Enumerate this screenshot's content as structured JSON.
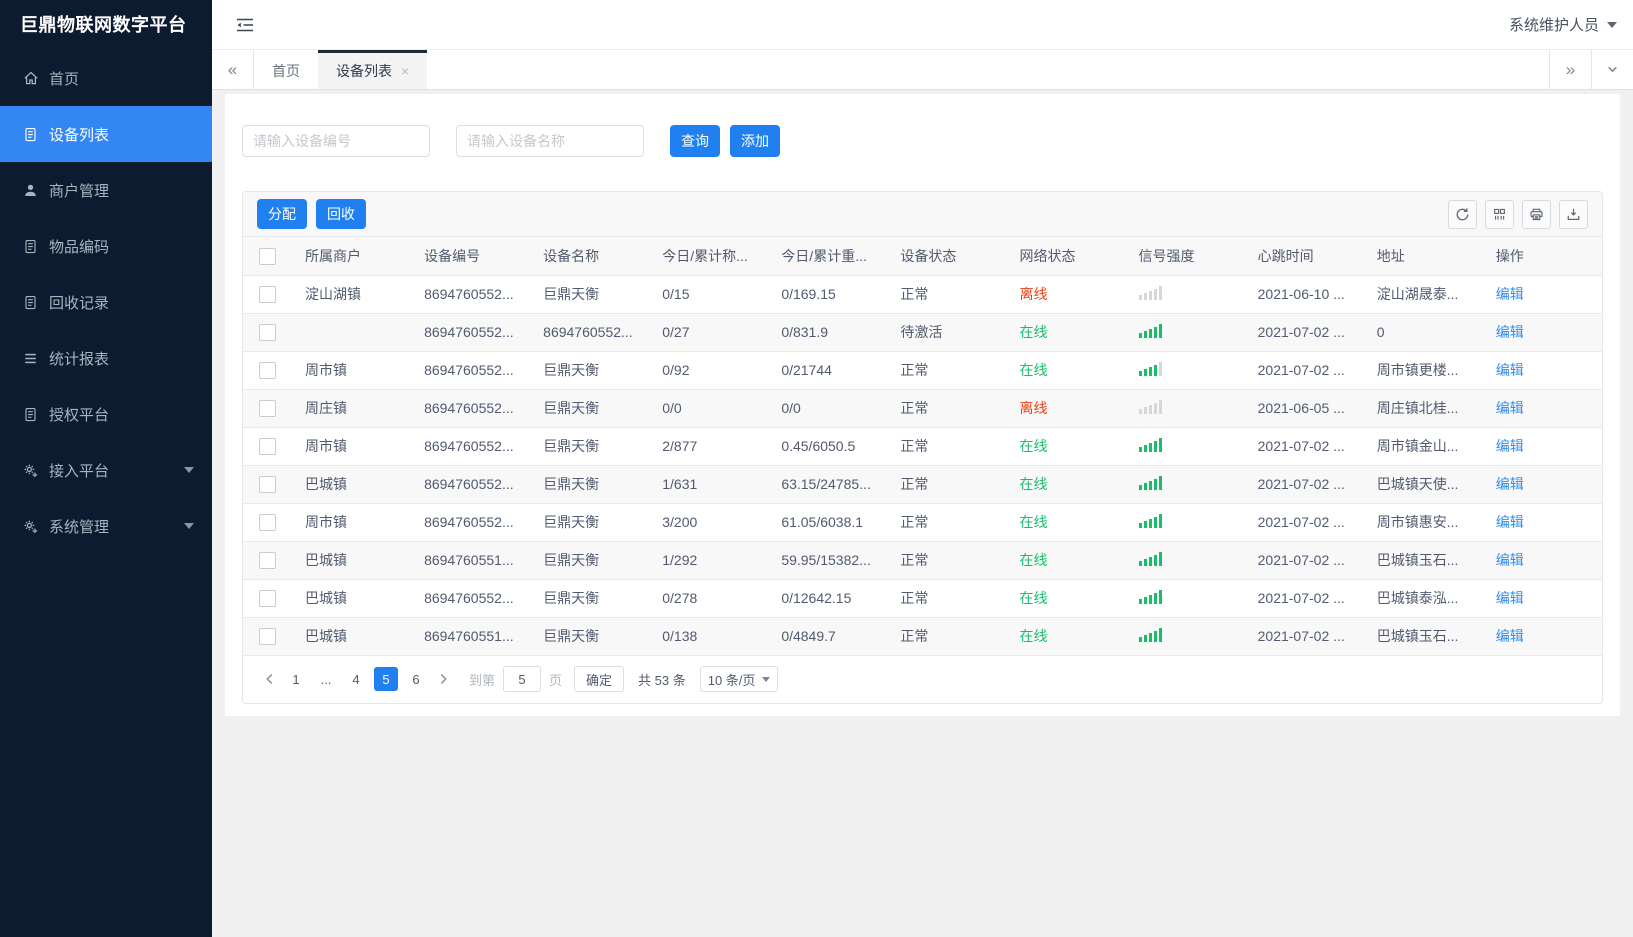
{
  "app": {
    "title": "巨鼎物联网数字平台",
    "user": "系统维护人员"
  },
  "colors": {
    "primary": "#2080f0",
    "green": "#19be6b",
    "red": "#ed4014",
    "link": "#2d8cf0",
    "sidebar": "#0d1b30",
    "active_menu": "#3486f5"
  },
  "sidebar": {
    "items": [
      {
        "id": "home",
        "label": "首页",
        "icon": "home-icon",
        "type": "home",
        "active": false,
        "arrow": false
      },
      {
        "id": "device-list",
        "label": "设备列表",
        "icon": "device-list-icon",
        "type": "doc",
        "active": true,
        "arrow": false
      },
      {
        "id": "merchant-manage",
        "label": "商户管理",
        "icon": "merchant-icon",
        "type": "person",
        "active": false,
        "arrow": false
      },
      {
        "id": "item-code",
        "label": "物品编码",
        "icon": "item-code-icon",
        "type": "doc",
        "active": false,
        "arrow": false
      },
      {
        "id": "recycle-record",
        "label": "回收记录",
        "icon": "recycle-record-icon",
        "type": "doc",
        "active": false,
        "arrow": false
      },
      {
        "id": "report",
        "label": "统计报表",
        "icon": "report-icon",
        "type": "bars",
        "active": false,
        "arrow": false
      },
      {
        "id": "auth-platform",
        "label": "授权平台",
        "icon": "auth-platform-icon",
        "type": "doc",
        "active": false,
        "arrow": false
      },
      {
        "id": "access-platform",
        "label": "接入平台",
        "icon": "access-platform-icon",
        "type": "gear",
        "active": false,
        "arrow": true
      },
      {
        "id": "system-manage",
        "label": "系统管理",
        "icon": "system-manage-icon",
        "type": "gear",
        "active": false,
        "arrow": true
      }
    ]
  },
  "tabs": {
    "items": [
      {
        "label": "首页",
        "active": false,
        "closable": false
      },
      {
        "label": "设备列表",
        "active": true,
        "closable": true
      }
    ]
  },
  "search": {
    "device_no_placeholder": "请输入设备编号",
    "device_name_placeholder": "请输入设备名称",
    "query_label": "查询",
    "add_label": "添加"
  },
  "toolbar": {
    "assign_label": "分配",
    "recycle_label": "回收"
  },
  "table": {
    "headers": [
      "所属商户",
      "设备编号",
      "设备名称",
      "今日/累计称...",
      "今日/累计重...",
      "设备状态",
      "网络状态",
      "信号强度",
      "心跳时间",
      "地址",
      "操作"
    ],
    "edit_label": "编辑",
    "rows": [
      {
        "merchant": "淀山湖镇",
        "device_no": "8694760552...",
        "device_name": "巨鼎天衡",
        "today_count": "0/15",
        "today_weight": "0/169.15",
        "device_status": "正常",
        "network": "离线",
        "network_state": "red",
        "signal": 0,
        "heartbeat": "2021-06-10 ...",
        "address": "淀山湖晟泰..."
      },
      {
        "merchant": "",
        "device_no": "8694760552...",
        "device_name": "8694760552...",
        "today_count": "0/27",
        "today_weight": "0/831.9",
        "device_status": "待激活",
        "network": "在线",
        "network_state": "green",
        "signal": 5,
        "heartbeat": "2021-07-02 ...",
        "address": "0"
      },
      {
        "merchant": "周市镇",
        "device_no": "8694760552...",
        "device_name": "巨鼎天衡",
        "today_count": "0/92",
        "today_weight": "0/21744",
        "device_status": "正常",
        "network": "在线",
        "network_state": "green",
        "signal": 4,
        "heartbeat": "2021-07-02 ...",
        "address": "周市镇更楼..."
      },
      {
        "merchant": "周庄镇",
        "device_no": "8694760552...",
        "device_name": "巨鼎天衡",
        "today_count": "0/0",
        "today_weight": "0/0",
        "device_status": "正常",
        "network": "离线",
        "network_state": "red",
        "signal": 0,
        "heartbeat": "2021-06-05 ...",
        "address": "周庄镇北桂..."
      },
      {
        "merchant": "周市镇",
        "device_no": "8694760552...",
        "device_name": "巨鼎天衡",
        "today_count": "2/877",
        "today_weight": "0.45/6050.5",
        "device_status": "正常",
        "network": "在线",
        "network_state": "green",
        "signal": 5,
        "heartbeat": "2021-07-02 ...",
        "address": "周市镇金山..."
      },
      {
        "merchant": "巴城镇",
        "device_no": "8694760552...",
        "device_name": "巨鼎天衡",
        "today_count": "1/631",
        "today_weight": "63.15/24785...",
        "device_status": "正常",
        "network": "在线",
        "network_state": "green",
        "signal": 5,
        "heartbeat": "2021-07-02 ...",
        "address": "巴城镇天使..."
      },
      {
        "merchant": "周市镇",
        "device_no": "8694760552...",
        "device_name": "巨鼎天衡",
        "today_count": "3/200",
        "today_weight": "61.05/6038.1",
        "device_status": "正常",
        "network": "在线",
        "network_state": "green",
        "signal": 5,
        "heartbeat": "2021-07-02 ...",
        "address": "周市镇惠安..."
      },
      {
        "merchant": "巴城镇",
        "device_no": "8694760551...",
        "device_name": "巨鼎天衡",
        "today_count": "1/292",
        "today_weight": "59.95/15382...",
        "device_status": "正常",
        "network": "在线",
        "network_state": "green",
        "signal": 5,
        "heartbeat": "2021-07-02 ...",
        "address": "巴城镇玉石..."
      },
      {
        "merchant": "巴城镇",
        "device_no": "8694760552...",
        "device_name": "巨鼎天衡",
        "today_count": "0/278",
        "today_weight": "0/12642.15",
        "device_status": "正常",
        "network": "在线",
        "network_state": "green",
        "signal": 5,
        "heartbeat": "2021-07-02 ...",
        "address": "巴城镇泰泓..."
      },
      {
        "merchant": "巴城镇",
        "device_no": "8694760551...",
        "device_name": "巨鼎天衡",
        "today_count": "0/138",
        "today_weight": "0/4849.7",
        "device_status": "正常",
        "network": "在线",
        "network_state": "green",
        "signal": 5,
        "heartbeat": "2021-07-02 ...",
        "address": "巴城镇玉石..."
      }
    ]
  },
  "pagination": {
    "pages": [
      {
        "label": "1",
        "active": false
      },
      {
        "label": "...",
        "active": false
      },
      {
        "label": "4",
        "active": false
      },
      {
        "label": "5",
        "active": true
      },
      {
        "label": "6",
        "active": false
      }
    ],
    "goto_label": "到第",
    "goto_value": "5",
    "page_unit_label": "页",
    "confirm_label": "确定",
    "total_label": "共 53 条",
    "page_size_label": "10 条/页"
  }
}
